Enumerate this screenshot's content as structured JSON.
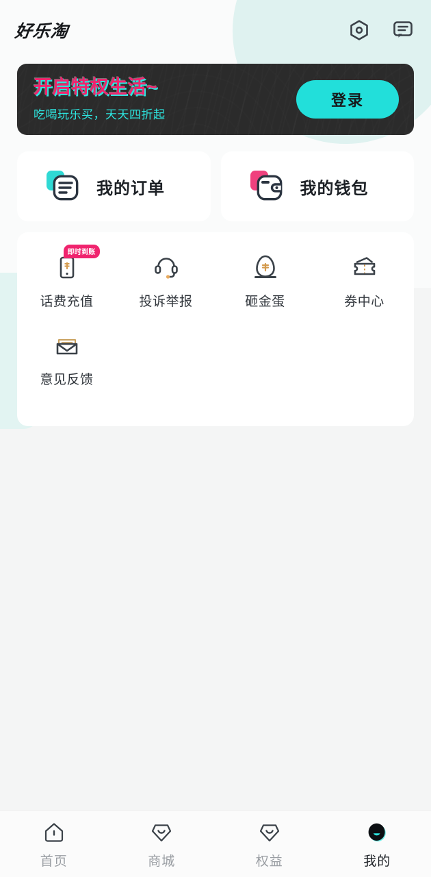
{
  "app": {
    "logo": "好乐淘",
    "accent_cyan": "#22dfda",
    "accent_pink": "#f0246e",
    "page_bg": "#f4f5f5"
  },
  "header": {
    "icons": [
      {
        "name": "settings-hexagon-icon",
        "label": "设置"
      },
      {
        "name": "message-icon",
        "label": "消息"
      }
    ]
  },
  "banner": {
    "title": "开启特权生活~",
    "subtitle": "吃喝玩乐买，天天四折起",
    "login_label": "登录"
  },
  "entries": [
    {
      "label": "我的订单",
      "icon": "order-document-icon",
      "color": "#2fd9d4"
    },
    {
      "label": "我的钱包",
      "icon": "wallet-icon",
      "color": "#f0417e"
    }
  ],
  "services": [
    {
      "label": "话费充值",
      "icon": "phone-recharge-icon",
      "badge": "即时到账"
    },
    {
      "label": "投诉举报",
      "icon": "headset-icon",
      "badge": ""
    },
    {
      "label": "砸金蛋",
      "icon": "golden-egg-icon",
      "badge": ""
    },
    {
      "label": "券中心",
      "icon": "coupon-ticket-icon",
      "badge": ""
    },
    {
      "label": "意见反馈",
      "icon": "envelope-feedback-icon",
      "badge": ""
    }
  ],
  "tabbar": [
    {
      "label": "首页",
      "icon": "home-icon",
      "active": false
    },
    {
      "label": "商城",
      "icon": "mall-icon",
      "active": false
    },
    {
      "label": "权益",
      "icon": "benefits-icon",
      "active": false
    },
    {
      "label": "我的",
      "icon": "profile-icon",
      "active": true
    }
  ]
}
